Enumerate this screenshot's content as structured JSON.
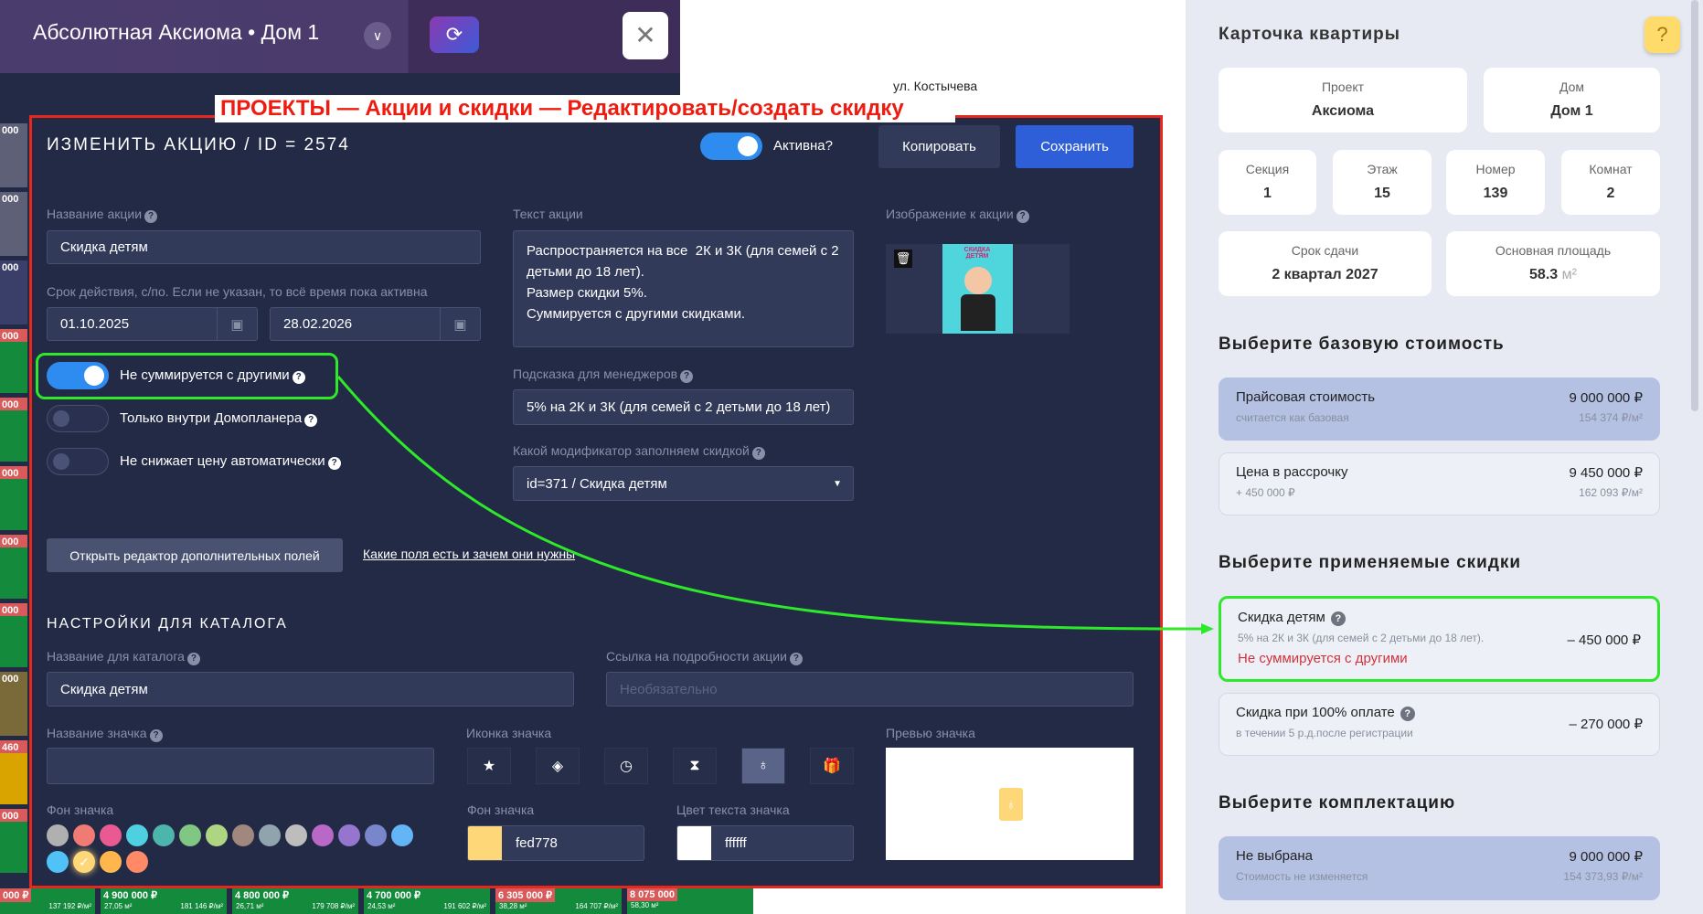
{
  "header": {
    "project_title": "Абсолютная Аксиома • Дом 1",
    "street": "ул. Костычева"
  },
  "annotation": "ПРОЕКТЫ — Акции и скидки — Редактировать/создать скидку",
  "left_strip": [
    "000",
    "000",
    "000",
    "000",
    "000",
    "000",
    "000",
    "000",
    "000",
    "460",
    "000"
  ],
  "bottom_row": [
    {
      "price": "000 ₽",
      "area": "",
      "ppm": "137 192 ₽/м²",
      "red": true
    },
    {
      "price": "4 900 000 ₽",
      "area": "27,05 м²",
      "ppm": "181 146 ₽/м²",
      "red": false
    },
    {
      "price": "4 800 000 ₽",
      "area": "26,71 м²",
      "ppm": "179 708 ₽/м²",
      "red": false
    },
    {
      "price": "4 700 000 ₽",
      "area": "24,53 м²",
      "ppm": "191 602 ₽/м²",
      "red": false
    },
    {
      "price": "6 305 000 ₽",
      "area": "38,28 м²",
      "ppm": "164 707 ₽/м²",
      "red": true
    },
    {
      "price": "8 075 000",
      "area": "58,30 м²",
      "ppm": "",
      "red": true
    }
  ],
  "modal": {
    "title": "ИЗМЕНИТЬ АКЦИЮ / ID = 2574",
    "active_label": "Активна?",
    "active": true,
    "copy_label": "Копировать",
    "save_label": "Сохранить",
    "name_label": "Название акции",
    "name_value": "Скидка детям",
    "period_label": "Срок действия, с/по. Если не указан, то всё время пока активна",
    "date_from": "01.10.2025",
    "date_to": "28.02.2026",
    "text_label": "Текст акции",
    "text_value": "Распространяется на все  2К и 3К (для семей с 2 детьми до 18 лет).\nРазмер скидки 5%.\nСуммируется с другими скидками.",
    "image_label": "Изображение к акции",
    "image_caption": "СКИДКА ДЕТЯМ",
    "toggles": [
      {
        "label": "Не суммируется с другими",
        "on": true
      },
      {
        "label": "Только внутри Домопланера",
        "on": false
      },
      {
        "label": "Не снижает цену автоматически",
        "on": false
      }
    ],
    "hint_label": "Подсказка для менеджеров",
    "hint_value": "5% на 2К и 3К (для семей с 2 детьми до 18 лет)",
    "modifier_label": "Какой модификатор заполняем скидкой",
    "modifier_value": "id=371 / Скидка детям",
    "extra_fields_button": "Открыть редактор дополнительных полей",
    "extra_fields_link": "Какие поля есть и зачем они нужны",
    "catalog_heading": "НАСТРОЙКИ ДЛЯ КАТАЛОГА",
    "catalog_name_label": "Название для каталога",
    "catalog_name_value": "Скидка детям",
    "link_label": "Ссылка на подробности акции",
    "link_placeholder": "Необязательно",
    "badge_name_label": "Название значка",
    "badge_name_value": "",
    "badge_icon_label": "Иконка значка",
    "badge_icons": [
      "star",
      "gem",
      "clock",
      "hourglass",
      "award",
      "gift"
    ],
    "badge_icon_selected": 4,
    "badge_preview_label": "Превью значка",
    "badge_bg_label": "Фон значка",
    "palette": [
      "#b0b0b0",
      "#f07b74",
      "#ea5a92",
      "#4fd0e0",
      "#4db6ac",
      "#81c784",
      "#aed581",
      "#a1887f",
      "#90a4ae",
      "#bdbdbd",
      "#ba68c8",
      "#9575cd",
      "#7986cb",
      "#64b5f6",
      "#4fc3f7",
      "#fed778",
      "#ffb74d",
      "#ff8a65"
    ],
    "palette_selected": 15,
    "badge_bg_field_label": "Фон значка",
    "badge_bg_value": "fed778",
    "badge_bg_color": "#fed778",
    "badge_text_color_label": "Цвет текста значка",
    "badge_text_color_value": "ffffff",
    "badge_text_color": "#ffffff"
  },
  "apartment": {
    "title": "Карточка квартиры",
    "fields": [
      {
        "k": "Проект",
        "v": "Аксиома"
      },
      {
        "k": "Дом",
        "v": "Дом 1"
      },
      {
        "k": "Секция",
        "v": "1"
      },
      {
        "k": "Этаж",
        "v": "15"
      },
      {
        "k": "Номер",
        "v": "139"
      },
      {
        "k": "Комнат",
        "v": "2"
      },
      {
        "k": "Срок сдачи",
        "v": "2 квартал 2027"
      },
      {
        "k": "Основная площадь",
        "v": "58.3",
        "unit": "м²"
      }
    ],
    "base_heading": "Выберите базовую стоимость",
    "base_options": [
      {
        "name": "Прайсовая стоимость",
        "desc": "считается как базовая",
        "price": "9 000 000 ₽",
        "ppm": "154 374 ₽/м²"
      },
      {
        "name": "Цена в рассрочку",
        "desc": "+ 450 000 ₽",
        "price": "9 450 000 ₽",
        "ppm": "162 093 ₽/м²"
      }
    ],
    "discount_heading": "Выберите применяемые скидки",
    "discounts": [
      {
        "name": "Скидка детям",
        "desc": "5% на 2К и 3К (для семей с 2 детьми до 18 лет).",
        "warn": "Не суммируется с другими",
        "amount": "– 450 000 ₽"
      },
      {
        "name": "Скидка при 100% оплате",
        "desc": "в течении 5 р.д.после регистрации",
        "amount": "– 270 000 ₽"
      }
    ],
    "finish_heading": "Выберите комплектацию",
    "finish_options": [
      {
        "name": "Не выбрана",
        "desc": "Стоимость не изменяется",
        "price": "9 000 000 ₽",
        "ppm": "154 373,93 ₽/м²"
      }
    ]
  }
}
